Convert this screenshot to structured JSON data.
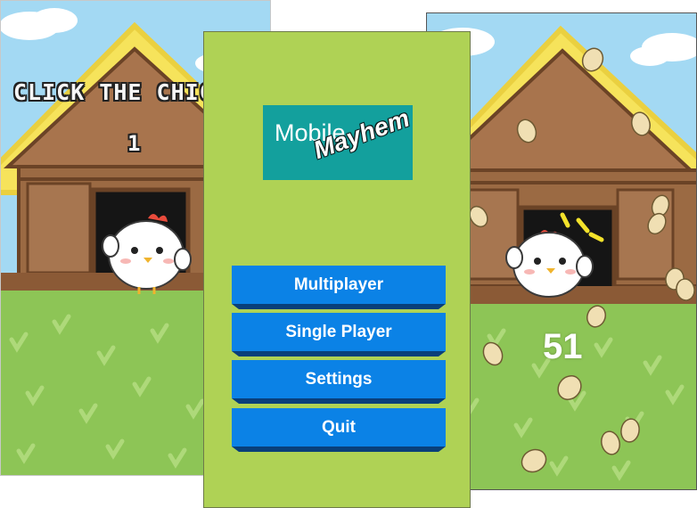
{
  "left_screen": {
    "title": "CLICK THE CHIC",
    "counter": "1"
  },
  "menu": {
    "logo_line1": "Mobile",
    "logo_line2": "Mayhem",
    "buttons": {
      "multiplayer": "Multiplayer",
      "single_player": "Single Player",
      "settings": "Settings",
      "quit": "Quit"
    }
  },
  "right_screen": {
    "score": "51"
  },
  "colors": {
    "menu_background": "#afd255",
    "logo_background": "#13a09d",
    "button_face": "#0b82e6",
    "button_edge": "#093f7a",
    "sky": "#9fd7f2",
    "grass": "#8bc554",
    "roof": "#f7e35a",
    "barn": "#a87550"
  }
}
